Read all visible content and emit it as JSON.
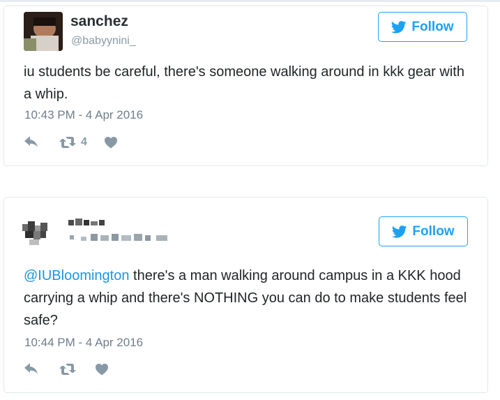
{
  "tweets": [
    {
      "author_name": "sanchez",
      "author_handle": "@babyynini_",
      "follow_label": "Follow",
      "text": "iu students be careful, there's someone walking around in kkk gear with a whip.",
      "timestamp": "10:43 PM - 4 Apr 2016",
      "retweet_count": "4",
      "avatar_icon": "profile-photo"
    },
    {
      "author_name": "",
      "author_handle": "",
      "follow_label": "Follow",
      "mention": "@IUBloomington",
      "text_after_mention": " there's a man walking around campus in a KKK hood carrying a whip and there's NOTHING you can do to make students feel safe?",
      "timestamp": "10:44 PM - 4 Apr 2016",
      "retweet_count": "",
      "avatar_icon": "redacted-profile-photo"
    }
  ],
  "colors": {
    "twitter_blue": "#1da1f2",
    "link_blue": "#1b95e0",
    "muted_gray": "#8899a6",
    "border": "#e1e8ed"
  }
}
